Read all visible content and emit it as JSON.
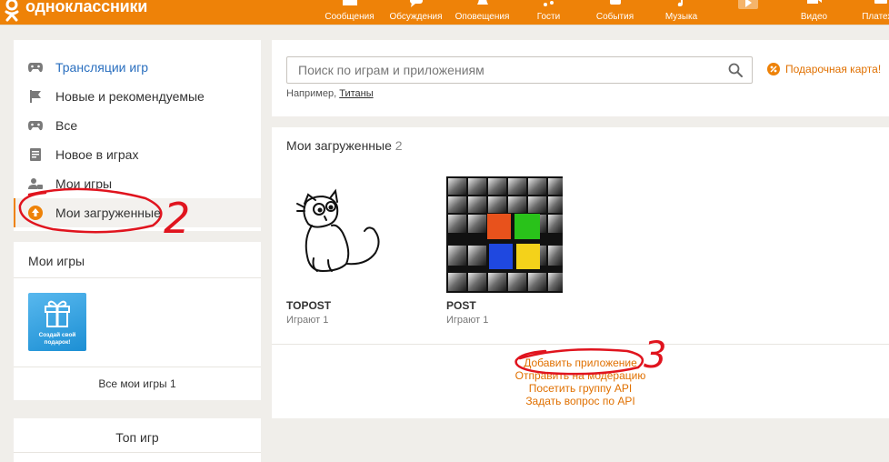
{
  "header": {
    "logo_text": "одноклассники",
    "nav": [
      {
        "label": "Сообщения",
        "icon": "envelope-icon"
      },
      {
        "label": "Обсуждения",
        "icon": "speech-bubbles-icon"
      },
      {
        "label": "Оповещения",
        "icon": "bell-icon"
      },
      {
        "label": "Гости",
        "icon": "footprints-icon",
        "active": true
      },
      {
        "label": "События",
        "icon": "star-icon"
      },
      {
        "label": "Музыка",
        "icon": "music-note-icon"
      },
      {
        "label": "",
        "icon": "video-play-icon"
      },
      {
        "label": "Видео",
        "icon": "video-camera-icon"
      },
      {
        "label": "Платежи",
        "icon": "payments-icon"
      }
    ],
    "accent": "#ee8208"
  },
  "sidebar": {
    "menu": [
      {
        "label": "Трансляции игр",
        "icon": "gamepad-icon"
      },
      {
        "label": "Новые и рекомендуемые",
        "icon": "flag-icon"
      },
      {
        "label": "Все",
        "icon": "gamepad-icon"
      },
      {
        "label": "Новое в играх",
        "icon": "news-icon"
      },
      {
        "label": "Мои игры",
        "icon": "user-games-icon"
      },
      {
        "label": "Мои загруженные",
        "icon": "upload-icon"
      }
    ],
    "my_games": {
      "title": "Мои игры",
      "gift_tile_text": "Создай свой подарок!",
      "footer": "Все мои игры 1"
    },
    "top_games": {
      "title": "Топ игр"
    }
  },
  "search": {
    "placeholder": "Поиск по играм и приложениям",
    "value": "",
    "hint_prefix": "Например,",
    "hint_link": "Титаны",
    "gift_card": "Подарочная карта!"
  },
  "uploaded": {
    "title": "Мои загруженные",
    "count": "2",
    "games": [
      {
        "name": "TOPOST",
        "plays": "Играют 1"
      },
      {
        "name": "POST",
        "plays": "Играют 1"
      }
    ],
    "links": [
      "Добавить приложение",
      "Отправить на модерацию",
      "Посетить группу API",
      "Задать вопрос по API"
    ]
  },
  "annotations": {
    "mark_2": "2",
    "mark_3": "3"
  }
}
